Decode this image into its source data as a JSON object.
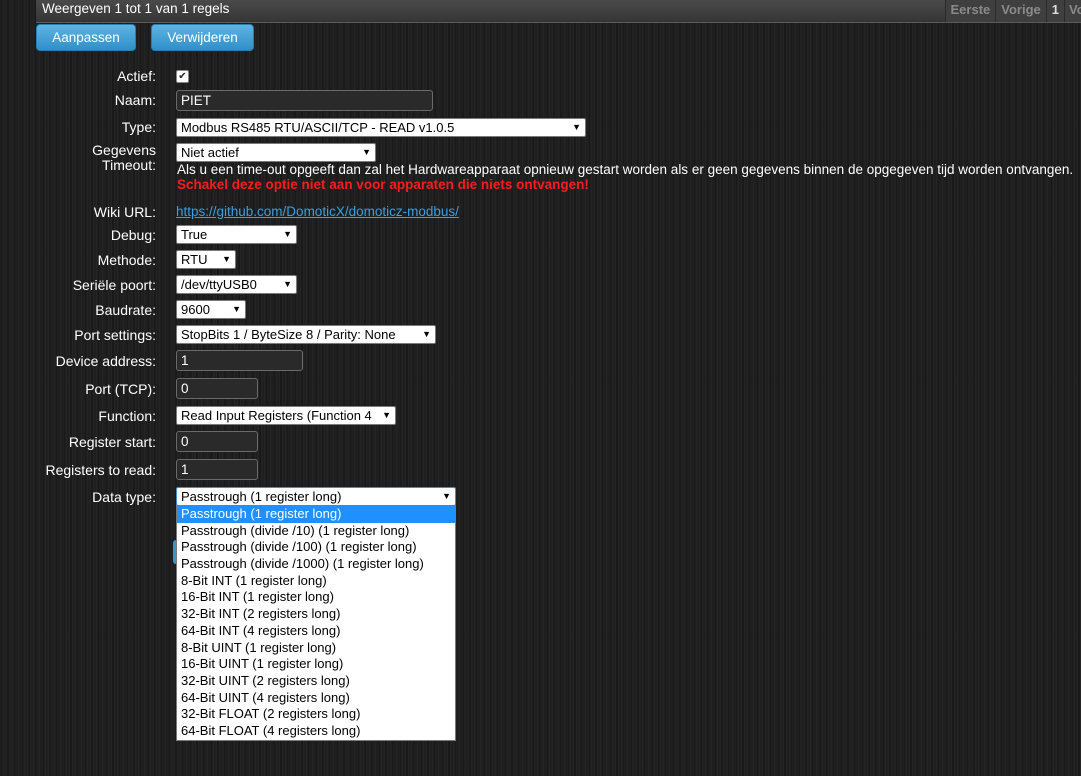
{
  "table": {
    "info": "Weergeven 1 tot 1 van 1 regels",
    "pager": {
      "first": "Eerste",
      "prev": "Vorige",
      "page": "1",
      "next_partial": "Vo"
    }
  },
  "buttons": {
    "update": "Aanpassen",
    "delete": "Verwijderen"
  },
  "form": {
    "active_label": "Actief:",
    "active_checked": true,
    "name_label": "Naam:",
    "name_value": "PIET",
    "type_label": "Type:",
    "type_value": "Modbus RS485 RTU/ASCII/TCP - READ v1.0.5",
    "timeout_label_1": "Gegevens",
    "timeout_label_2": "Timeout:",
    "timeout_value": "Niet actief",
    "timeout_help": "Als u een time-out opgeeft dan zal het Hardwareapparaat opnieuw gestart worden als er geen gegevens binnen de opgegeven tijd worden ontvangen.",
    "timeout_warning": "Schakel deze optie niet aan voor apparaten die niets ontvangen!",
    "wiki_label": "Wiki URL:",
    "wiki_url": "https://github.com/DomoticX/domoticz-modbus/",
    "debug_label": "Debug:",
    "debug_value": "True",
    "method_label": "Methode:",
    "method_value": "RTU",
    "serial_label": "Seriële poort:",
    "serial_value": "/dev/ttyUSB0",
    "baud_label": "Baudrate:",
    "baud_value": "9600",
    "portset_label": "Port settings:",
    "portset_value": "StopBits 1 / ByteSize 8 / Parity: None",
    "address_label": "Device address:",
    "address_value": "1",
    "port_label": "Port (TCP):",
    "port_value": "0",
    "function_label": "Function:",
    "function_value": "Read Input Registers (Function 4",
    "regstart_label": "Register start:",
    "regstart_value": "0",
    "regcount_label": "Registers to read:",
    "regcount_value": "1",
    "datatype_label": "Data type:",
    "datatype_value": "Passtrough (1 register long)",
    "datatype_options": [
      "Passtrough (1 register long)",
      "Passtrough (divide /10) (1 register long)",
      "Passtrough (divide /100) (1 register long)",
      "Passtrough (divide /1000) (1 register long)",
      "8-Bit INT (1 register long)",
      "16-Bit INT (1 register long)",
      "32-Bit INT (2 registers long)",
      "64-Bit INT (4 registers long)",
      "8-Bit UINT (1 register long)",
      "16-Bit UINT (1 register long)",
      "32-Bit UINT (2 registers long)",
      "64-Bit UINT (4 registers long)",
      "32-Bit FLOAT (2 registers long)",
      "64-Bit FLOAT (4 registers long)"
    ],
    "datatype_selected_index": 0
  },
  "colors": {
    "accent": "#2f8fca",
    "warning": "#ff1a1a",
    "link": "#3b9fe0",
    "highlight": "#1e90ff"
  }
}
